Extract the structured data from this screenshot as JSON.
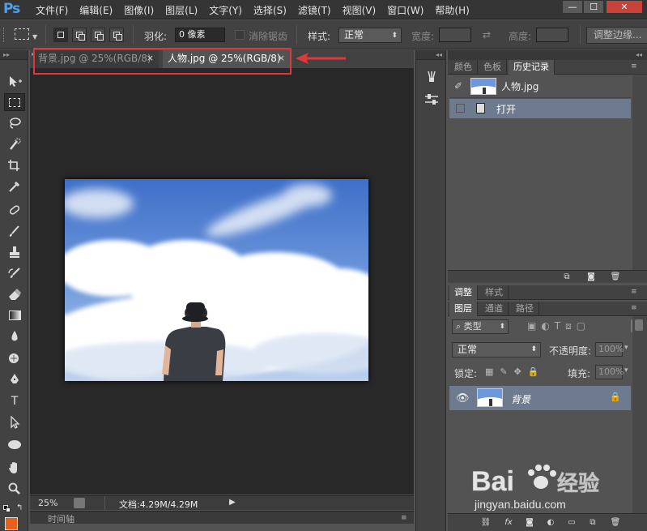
{
  "app": {
    "logo": "Ps",
    "menus": [
      "文件(F)",
      "编辑(E)",
      "图像(I)",
      "图层(L)",
      "文字(Y)",
      "选择(S)",
      "滤镜(T)",
      "视图(V)",
      "窗口(W)",
      "帮助(H)"
    ],
    "window_buttons": {
      "minimize": "—",
      "maximize": "☐",
      "close": "✕"
    }
  },
  "options_bar": {
    "feather_label": "羽化:",
    "feather_value": "0 像素",
    "antialias_label": "消除锯齿",
    "style_label": "样式:",
    "style_value": "正常",
    "width_label": "宽度:",
    "height_label": "高度:",
    "refine_edge_button": "调整边缘..."
  },
  "toolbox": {
    "tools": [
      "move-tool",
      "rectangular-marquee-tool",
      "lasso-tool",
      "quick-selection-tool",
      "crop-tool",
      "eyedropper-tool",
      "spot-healing-tool",
      "brush-tool",
      "clone-stamp-tool",
      "history-brush-tool",
      "eraser-tool",
      "gradient-tool",
      "blur-tool",
      "dodge-tool",
      "pen-tool",
      "type-tool",
      "path-selection-tool",
      "ellipse-tool",
      "hand-tool",
      "zoom-tool"
    ],
    "type_tool_glyph": "T",
    "foreground_color": "#e8601c"
  },
  "documents": {
    "tabs": [
      {
        "label": "背景.jpg @ 25%(RGB/8)",
        "active": false
      },
      {
        "label": "人物.jpg @ 25%(RGB/8)",
        "active": true
      }
    ],
    "tab_close": "×"
  },
  "status_bar": {
    "zoom": "25%",
    "doc_info": "文档:4.29M/4.29M",
    "timeline_label": "时间轴"
  },
  "history_panel": {
    "tabs": [
      "颜色",
      "色板",
      "历史记录"
    ],
    "active_tab": "历史记录",
    "snapshot_name": "人物.jpg",
    "steps": [
      "打开"
    ]
  },
  "adjust_panel": {
    "tabs": [
      "调整",
      "样式"
    ]
  },
  "layers_panel": {
    "tabs": [
      "图层",
      "通道",
      "路径"
    ],
    "active_tab": "图层",
    "filter_kind": "类型",
    "blend_mode": "正常",
    "opacity_label": "不透明度:",
    "opacity_value": "100%",
    "lock_label": "锁定:",
    "fill_label": "填充:",
    "fill_value": "100%",
    "layers": [
      {
        "name": "背景",
        "locked": true,
        "visible": true
      }
    ]
  },
  "watermark": {
    "text": "Bai",
    "text2": "经验",
    "url": "jingyan.baidu.com"
  },
  "colors": {
    "highlight": "#e0373a",
    "selected_row": "#6e7b8f",
    "ps_blue": "#4fa0e8"
  }
}
